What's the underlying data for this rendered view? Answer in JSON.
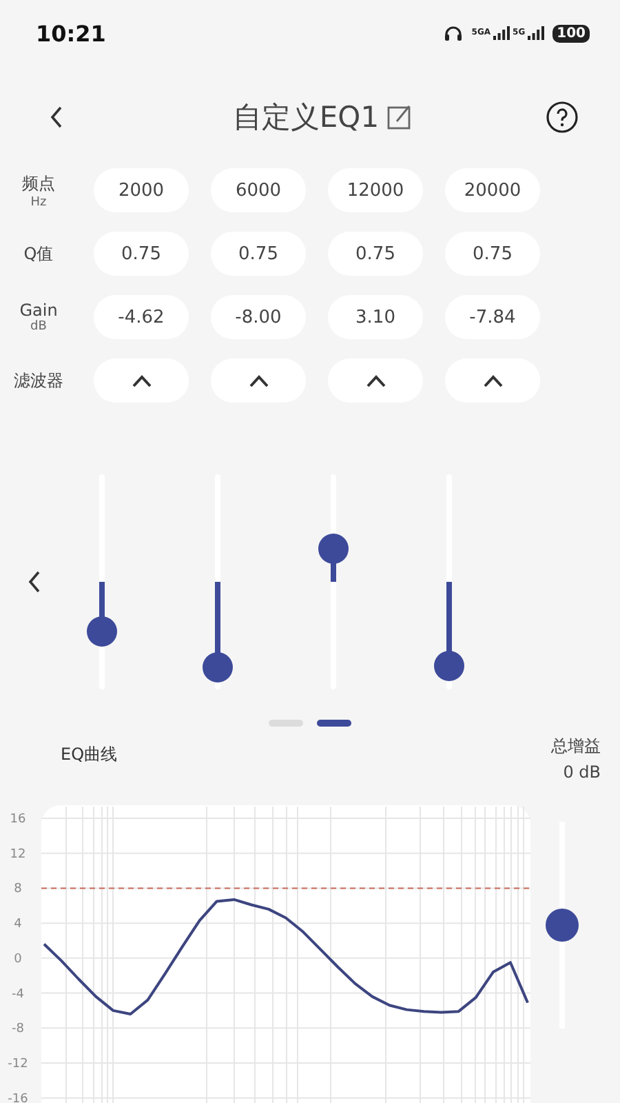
{
  "status_bar": {
    "time": "10:21",
    "sim_1": "5GA",
    "sim_2": "5G",
    "battery": "100"
  },
  "header": {
    "title": "自定义EQ1"
  },
  "params": {
    "rows": [
      {
        "label": "频点",
        "unit": "Hz",
        "kind": "text",
        "values": [
          "2000",
          "6000",
          "12000",
          "20000"
        ]
      },
      {
        "label": "Q值",
        "kind": "text",
        "values": [
          "0.75",
          "0.75",
          "0.75",
          "0.75"
        ]
      },
      {
        "label": "Gain",
        "unit": "dB",
        "kind": "text",
        "values": [
          "-4.62",
          "-8.00",
          "3.10",
          "-7.84"
        ]
      },
      {
        "label": "滤波器",
        "kind": "filter",
        "filters": [
          {
            "kind": "peak"
          },
          {
            "kind": "peak"
          },
          {
            "kind": "peak"
          },
          {
            "kind": "peak"
          }
        ]
      }
    ]
  },
  "bands": [
    {
      "level": 0.269
    },
    {
      "level": 0.1
    },
    {
      "level": 0.655
    },
    {
      "level": 0.108
    }
  ],
  "pages": [
    {
      "selected": false
    },
    {
      "selected": true
    }
  ],
  "eq_curve": {
    "title": "EQ曲线",
    "chart_data": {
      "type": "line",
      "categories": [
        null,
        null,
        null,
        null,
        null,
        null,
        null,
        null,
        null,
        null,
        null,
        null,
        null,
        null,
        null,
        null,
        null,
        null,
        null,
        null,
        null,
        null,
        null,
        null,
        null,
        null,
        null,
        null,
        null
      ],
      "ylim": [
        -18,
        17.5
      ],
      "yticks": [
        16,
        12,
        8,
        4,
        0,
        -4,
        -8,
        -12,
        -16
      ],
      "grid": true,
      "ref_lines": [
        {
          "axis": "y",
          "value": 8,
          "color": "#c96a5a"
        }
      ],
      "series": [
        {
          "color": "#3d4580",
          "values": [
            1.6,
            -0.3,
            -2.4,
            -4.4,
            -6.0,
            -6.4,
            -4.8,
            -1.8,
            1.3,
            4.3,
            6.5,
            6.7,
            6.1,
            5.6,
            4.6,
            3.0,
            1.0,
            -1.0,
            -2.9,
            -4.4,
            -5.4,
            -5.9,
            -6.1,
            -6.2,
            -6.1,
            -4.5,
            -1.6,
            -0.5,
            -5.1
          ]
        }
      ]
    }
  },
  "total_gain": {
    "label": "总增益",
    "reading": "0 dB",
    "level": 0.5
  }
}
